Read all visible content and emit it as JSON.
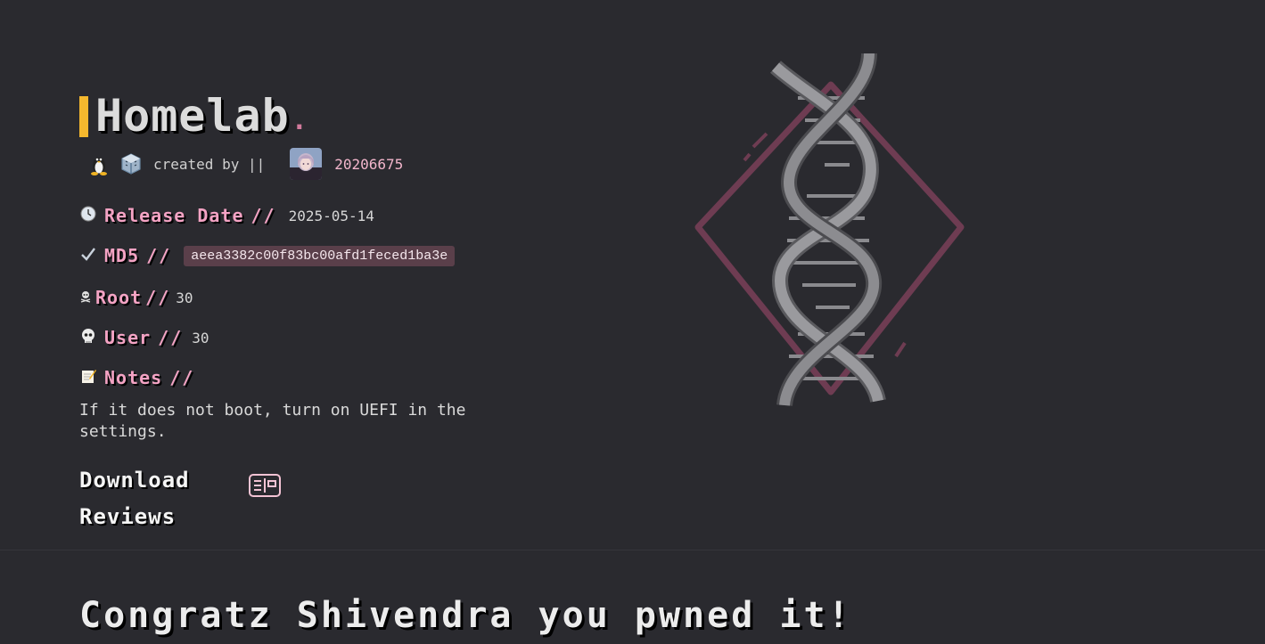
{
  "machine": {
    "title": "Homelab",
    "title_dot": ".",
    "created_by_label": "created by ||",
    "creator_id": "20206675",
    "platform_icons": [
      "linux-icon",
      "virtualbox-icon"
    ]
  },
  "info": {
    "release_date_label": "Release Date",
    "release_date_sep": "//",
    "release_date_value": "2025-05-14",
    "md5_label": "MD5",
    "md5_sep": "//",
    "md5_value": "aeea3382c00f83bc00afd1feced1ba3e",
    "root_label": "Root",
    "root_sep": "//",
    "root_value": "30",
    "user_label": "User",
    "user_sep": "//",
    "user_value": "30",
    "notes_label": "Notes",
    "notes_sep": "//",
    "notes_text": "If it does not boot, turn on UEFI in the settings."
  },
  "actions": {
    "download_label": "Download",
    "reviews_label": "Reviews"
  },
  "congrats": {
    "text": "Congratz Shivendra you pwned it!"
  },
  "colors": {
    "background": "#2a2a2f",
    "accent_pink": "#f4a3c4",
    "title_bar": "#f5b82e",
    "md5_chip": "#5a3f4a"
  }
}
